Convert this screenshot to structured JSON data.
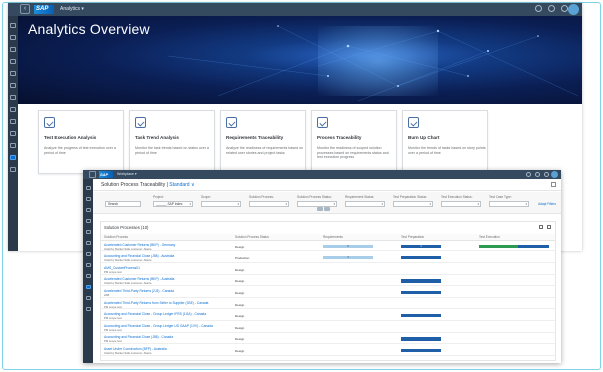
{
  "overview": {
    "shell": {
      "logo": "SAP",
      "app_menu": "Analytics ▾"
    },
    "title": "Analytics Overview",
    "rail_icons": [
      "home-icon",
      "compass-icon",
      "list-icon",
      "grid-icon",
      "chart-icon",
      "document-icon",
      "layers-icon",
      "bookmark-icon",
      "calendar-icon",
      "copy-icon",
      "user-icon",
      "analytics-icon",
      "alert-icon"
    ],
    "tiles": [
      {
        "icon": "target-icon",
        "title": "Test Execution Analysis",
        "desc": "Analyze the progress of test execution over a period of time"
      },
      {
        "icon": "checklist-icon",
        "title": "Task Trend Analysis",
        "desc": "Monitor the task trends based on status over a period of time"
      },
      {
        "icon": "tools-icon",
        "title": "Requirements Traceability",
        "desc": "Analyze the readiness of requirements based on related user stories and project tasks"
      },
      {
        "icon": "process-icon",
        "title": "Process Traceability",
        "desc": "Monitor the readiness of scoped solution processes based on requirements status and test execution progress"
      },
      {
        "icon": "burnup-icon",
        "title": "Burn Up Chart",
        "desc": "Monitor the trends of tasks based on story points over a period of time"
      }
    ]
  },
  "traceability": {
    "shell": {
      "logo": "SAP",
      "app_menu": "Workplace ▾"
    },
    "page_title": "Solution Process Traceability",
    "variant": "Standard ∨",
    "filters": [
      {
        "label": "",
        "value": "Search"
      },
      {
        "label": "Project:",
        "value": "______ SAP Indec"
      },
      {
        "label": "Scope:",
        "value": ""
      },
      {
        "label": "Solution Process:",
        "value": ""
      },
      {
        "label": "Solution Process Status:",
        "value": ""
      },
      {
        "label": "Requirement Status:",
        "value": ""
      },
      {
        "label": "Test Preparation Status:",
        "value": ""
      },
      {
        "label": "Test Execution Status:",
        "value": ""
      },
      {
        "label": "Test Case Type:",
        "value": ""
      }
    ],
    "adapt_filters": "Adapt Filters",
    "table": {
      "title": "Solution Processes (10)",
      "columns": [
        "Solution Process",
        "Solution Process Status",
        "Requirements",
        "Test Preparation",
        "Test Execution"
      ],
      "rows": [
        {
          "name": "Accelerated Customer Returns (BKP) - Germany",
          "sub": "Initial by Market SAE customer: Alante",
          "status": "Design",
          "req": 1.0,
          "req_label": "5",
          "prep": 1.0,
          "prep_label": "1",
          "exec_g": 0.55,
          "exec_b": 0.45
        },
        {
          "name": "Accounting and Financial Close (J58) - Australia",
          "sub": "Initial by Market SAE customer: Alante",
          "status": "Production",
          "req": 1.0,
          "req_label": "3",
          "prep": 1.0,
          "prep_label": "",
          "exec_g": 0,
          "exec_b": 0
        },
        {
          "name": "AMS_CustomProcess01",
          "sub": "PM scope test",
          "status": "Design",
          "req": 0,
          "req_label": "",
          "prep": 0,
          "prep_label": "",
          "exec_g": 0,
          "exec_b": 0
        },
        {
          "name": "Accelerated Customer Returns (BKP) - Australia",
          "sub": "Initial by Market SAE customer: Alante",
          "status": "Design",
          "req": 0,
          "req_label": "",
          "prep": 1.0,
          "prep_label": "",
          "exec_g": 0,
          "exec_b": 0
        },
        {
          "name": "Accelerated Third-Party Returns (2J3) - Canada",
          "sub": "2AB",
          "status": "Design",
          "req": 0,
          "req_label": "",
          "prep": 1.0,
          "prep_label": "",
          "exec_g": 0,
          "exec_b": 0
        },
        {
          "name": "Accelerated Third-Party Returns from Seller to Supplier (3SE) - Canada",
          "sub": "PM scope test",
          "status": "Design",
          "req": 0,
          "req_label": "",
          "prep": 0,
          "prep_label": "",
          "exec_g": 0,
          "exec_b": 0
        },
        {
          "name": "Accounting and Financial Close - Group Ledger IFRS (1GA) - Canada",
          "sub": "PM scope test",
          "status": "Design",
          "req": 0,
          "req_label": "",
          "prep": 1.0,
          "prep_label": "",
          "exec_g": 0,
          "exec_b": 0
        },
        {
          "name": "Accounting and Financial Close - Group Ledger US GAAP (1VV) - Canada",
          "sub": "PM scope test",
          "status": "Design",
          "req": 0,
          "req_label": "",
          "prep": 0,
          "prep_label": "",
          "exec_g": 0,
          "exec_b": 0
        },
        {
          "name": "Accounting and Financial Close (J58) - Canada",
          "sub": "PM scope test",
          "status": "Design",
          "req": 0,
          "req_label": "",
          "prep": 1.0,
          "prep_label": "",
          "exec_g": 0,
          "exec_b": 0
        },
        {
          "name": "Asset Under Construction (BFP) - Australia",
          "sub": "Initial by Market SAE customer: Alante",
          "status": "Design",
          "req": 0,
          "req_label": "",
          "prep": 1.0,
          "prep_label": "",
          "exec_g": 0,
          "exec_b": 0
        }
      ]
    }
  }
}
